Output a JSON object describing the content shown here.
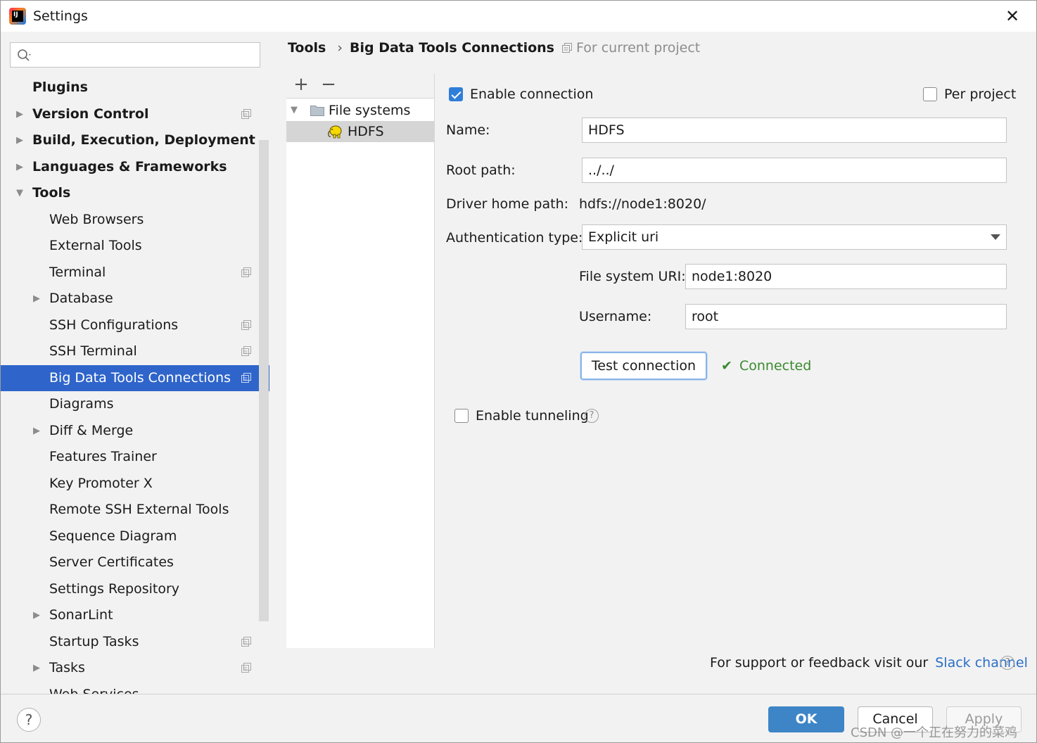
{
  "window": {
    "title": "Settings",
    "close_symbol": "✕",
    "logo_text": "IJ"
  },
  "sidebar": {
    "search_placeholder": "",
    "items": [
      {
        "label": "Plugins",
        "level": "top",
        "arrow": ""
      },
      {
        "label": "Version Control",
        "level": "top",
        "arrow": "▶"
      },
      {
        "label": "Build, Execution, Deployment",
        "level": "top",
        "arrow": "▶"
      },
      {
        "label": "Languages & Frameworks",
        "level": "top",
        "arrow": "▶"
      },
      {
        "label": "Tools",
        "level": "top",
        "arrow": "▼"
      },
      {
        "label": "Web Browsers",
        "level": "sub",
        "arrow": ""
      },
      {
        "label": "External Tools",
        "level": "sub",
        "arrow": ""
      },
      {
        "label": "Terminal",
        "level": "sub",
        "arrow": ""
      },
      {
        "label": "Database",
        "level": "sub",
        "arrow": "▶"
      },
      {
        "label": "SSH Configurations",
        "level": "sub",
        "arrow": ""
      },
      {
        "label": "SSH Terminal",
        "level": "sub",
        "arrow": ""
      },
      {
        "label": "Big Data Tools Connections",
        "level": "sub",
        "arrow": ""
      },
      {
        "label": "Diagrams",
        "level": "sub",
        "arrow": ""
      },
      {
        "label": "Diff & Merge",
        "level": "sub",
        "arrow": "▶"
      },
      {
        "label": "Features Trainer",
        "level": "sub",
        "arrow": ""
      },
      {
        "label": "Key Promoter X",
        "level": "sub",
        "arrow": ""
      },
      {
        "label": "Remote SSH External Tools",
        "level": "sub",
        "arrow": ""
      },
      {
        "label": "Sequence Diagram",
        "level": "sub",
        "arrow": ""
      },
      {
        "label": "Server Certificates",
        "level": "sub",
        "arrow": ""
      },
      {
        "label": "Settings Repository",
        "level": "sub",
        "arrow": ""
      },
      {
        "label": "SonarLint",
        "level": "sub",
        "arrow": "▶"
      },
      {
        "label": "Startup Tasks",
        "level": "sub",
        "arrow": ""
      },
      {
        "label": "Tasks",
        "level": "sub",
        "arrow": "▶"
      },
      {
        "label": "Web Services",
        "level": "sub",
        "arrow": ""
      }
    ]
  },
  "breadcrumb": {
    "parent": "Tools",
    "separator": "›",
    "current": "Big Data Tools Connections"
  },
  "scope_hint": "For current project",
  "connections": {
    "add_symbol": "+",
    "remove_symbol": "−",
    "group_label": "File systems",
    "item_label": "HDFS"
  },
  "form": {
    "enable_connection_label": "Enable connection",
    "enable_connection_checked": true,
    "per_project_label": "Per project",
    "per_project_checked": false,
    "name_label": "Name:",
    "name_value": "HDFS",
    "root_path_label": "Root path:",
    "root_path_value": "../../",
    "driver_home_label": "Driver home path:",
    "driver_home_value": "hdfs://node1:8020/",
    "auth_type_label": "Authentication type:",
    "auth_type_value": "Explicit uri",
    "fs_uri_label": "File system URI:",
    "fs_uri_value": "node1:8020",
    "username_label": "Username:",
    "username_value": "root",
    "test_button": "Test connection",
    "status_check": "✔",
    "status_text": "Connected",
    "enable_tunneling_label": "Enable tunneling",
    "enable_tunneling_checked": false,
    "help_symbol": "?"
  },
  "support": {
    "text": "For support or feedback visit our",
    "link": "Slack channel"
  },
  "footer": {
    "help_symbol": "?",
    "ok": "OK",
    "cancel": "Cancel",
    "apply": "Apply"
  },
  "watermark": "CSDN @一个正在努力的菜鸡",
  "colors": {
    "selection": "#2f65ca",
    "connected": "#3a8a2e",
    "link": "#2a6ec7",
    "ok_button": "#3d85c6"
  }
}
